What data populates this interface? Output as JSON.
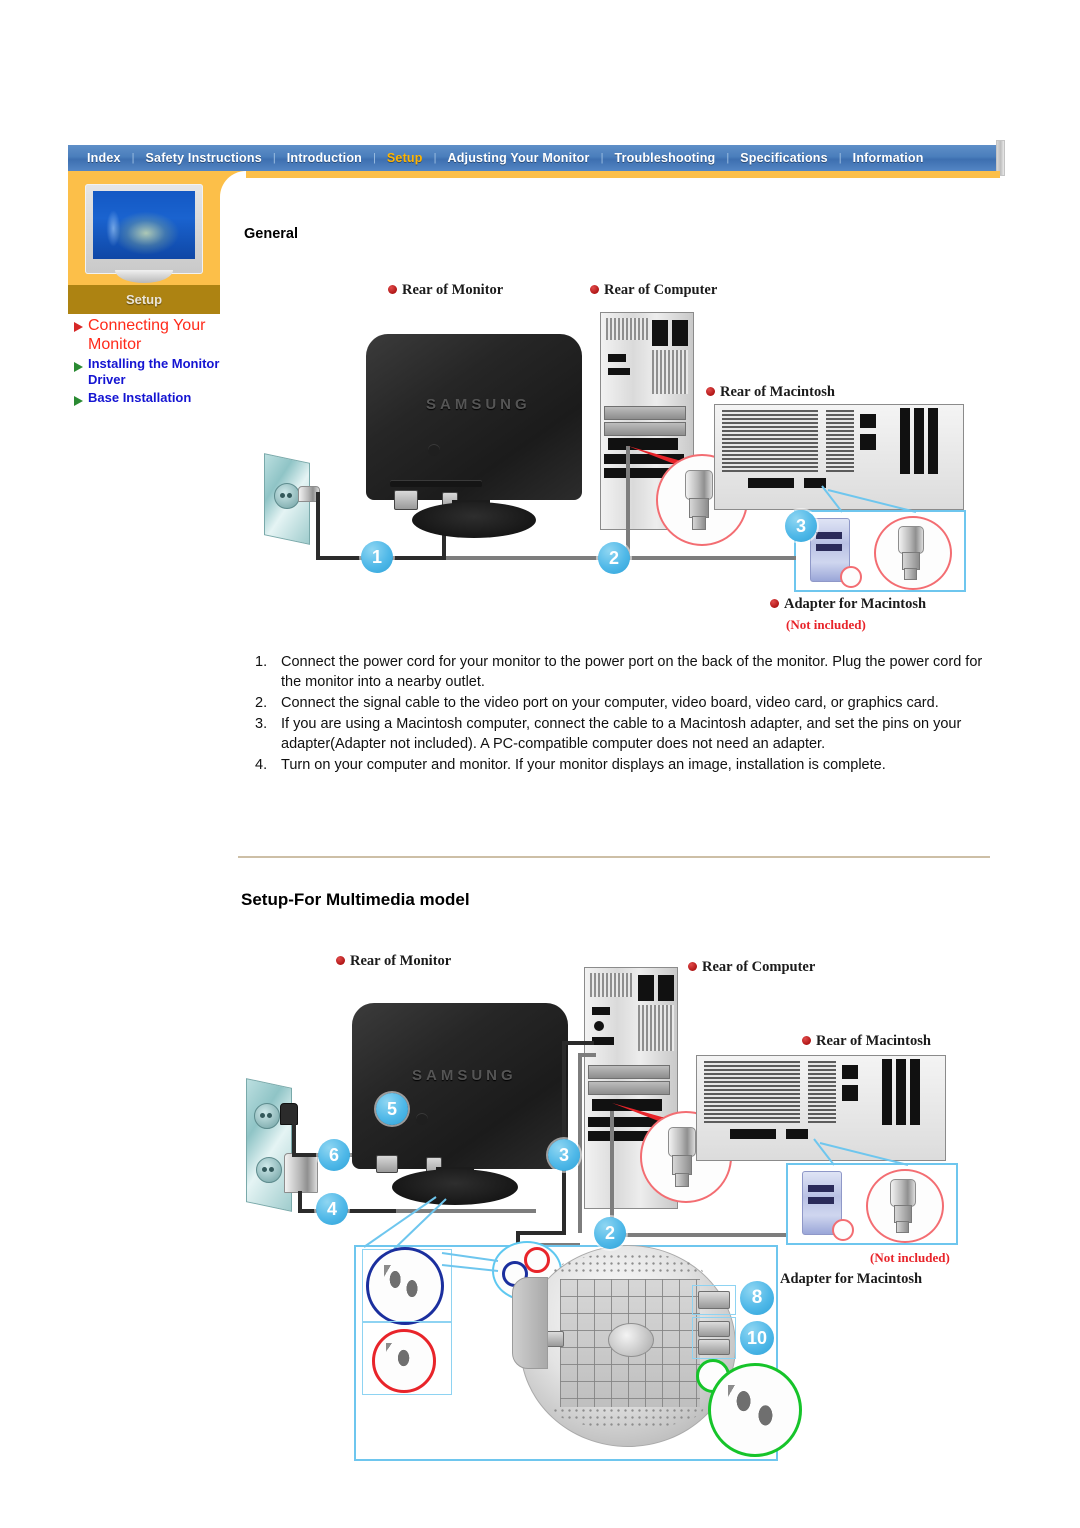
{
  "nav": {
    "items": [
      {
        "label": "Index",
        "active": false
      },
      {
        "label": "Safety Instructions",
        "active": false
      },
      {
        "label": "Introduction",
        "active": false
      },
      {
        "label": "Setup",
        "active": true
      },
      {
        "label": "Adjusting Your Monitor",
        "active": false
      },
      {
        "label": "Troubleshooting",
        "active": false
      },
      {
        "label": "Specifications",
        "active": false
      },
      {
        "label": "Information",
        "active": false
      }
    ],
    "separator": "|"
  },
  "sidebar": {
    "section_label": "Setup",
    "links": [
      {
        "label": "Connecting Your Monitor",
        "current": true
      },
      {
        "label": "Installing the Monitor Driver",
        "current": false
      },
      {
        "label": "Base Installation",
        "current": false
      }
    ]
  },
  "main": {
    "heading": "General",
    "subheading": "Setup-For Multimedia model",
    "steps": [
      {
        "num": "1.",
        "text": "Connect the power cord for your monitor to the power port on the back of the monitor. Plug the power cord for the monitor into a nearby outlet."
      },
      {
        "num": "2.",
        "text": "Connect the signal cable to the video port on your computer, video board, video card, or graphics card."
      },
      {
        "num": "3.",
        "text": "If you are using a Macintosh computer, connect the cable to a Macintosh adapter, and set the pins on your adapter(Adapter not included). A PC-compatible computer does not need an adapter."
      },
      {
        "num": "4.",
        "text": "Turn on your computer and monitor. If your monitor displays an image, installation is complete."
      }
    ]
  },
  "diagram_general": {
    "labels": {
      "rear_of_monitor": "Rear of Monitor",
      "rear_of_computer": "Rear of Computer",
      "rear_of_macintosh": "Rear of  Macintosh",
      "adapter_for_macintosh": "Adapter for Macintosh",
      "not_included": "(Not included)"
    },
    "monitor_brand": "SAMSUNG",
    "badges": [
      "1",
      "2",
      "3"
    ]
  },
  "diagram_multimedia": {
    "labels": {
      "rear_of_monitor": "Rear of Monitor",
      "rear_of_computer": "Rear of Computer",
      "rear_of_macintosh": "Rear of  Macintosh",
      "adapter_for_macintosh": "Adapter for Macintosh",
      "not_included": "(Not included)"
    },
    "monitor_brand": "SAMSUNG",
    "badges": [
      "5",
      "6",
      "4",
      "3",
      "2",
      "8",
      "10"
    ]
  },
  "colors": {
    "nav_blue": "#4a7ebc",
    "nav_active": "#ffb400",
    "sidebar_orange": "#fcbf49",
    "sidebar_label_bg": "#ad8312",
    "link_blue": "#1414d2",
    "link_red": "#ff2a1a",
    "badge_blue": "#4fb8e8",
    "label_red": "#e8242a",
    "divider": "#cdbfa6"
  }
}
